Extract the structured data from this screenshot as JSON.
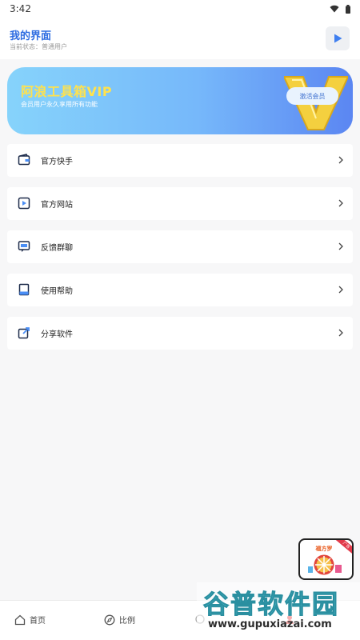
{
  "status_bar": {
    "time": "3:42",
    "icons": [
      "wifi-icon",
      "battery-icon"
    ]
  },
  "header": {
    "title": "我的界面",
    "subtitle": "当前状态：普通用户",
    "action_icon": "play-icon"
  },
  "vip_banner": {
    "title": "阿浪工具箱VIP",
    "subtitle": "会员用户永久享用所有功能",
    "button_label": "激活会员",
    "badge_letter": "V"
  },
  "menu": [
    {
      "label": "官方快手",
      "icon": "wallet-icon"
    },
    {
      "label": "官方网站",
      "icon": "play-box-icon"
    },
    {
      "label": "反馈群聊",
      "icon": "chat-icon"
    },
    {
      "label": "使用帮助",
      "icon": "book-icon"
    },
    {
      "label": "分享软件",
      "icon": "share-icon"
    }
  ],
  "ad_float": {
    "text": "福方罗",
    "tag": "广告"
  },
  "bottom_nav": [
    {
      "label": "首页",
      "icon": "home-icon"
    },
    {
      "label": "比例",
      "icon": "compass-icon"
    },
    {
      "label": "",
      "icon": "tool-icon"
    },
    {
      "label": "",
      "icon": "user-icon"
    }
  ],
  "watermark": {
    "title": "谷普软件园",
    "url": "www.gupuxiazai.com"
  },
  "colors": {
    "accent": "#2f6de1",
    "vip_gold": "#ffe24d",
    "background": "#f7f7f8"
  }
}
